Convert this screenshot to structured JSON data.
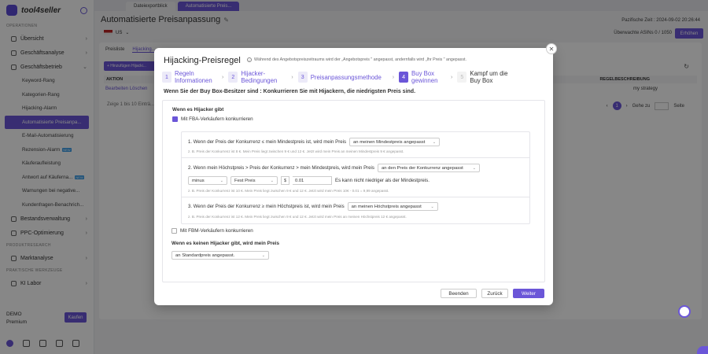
{
  "app": {
    "brand": "tool4seller",
    "sections": {
      "operations": "OPERATIONEN",
      "product_research": "PRODUKTRESEARCH",
      "tools": "PRAKTISCHE WERKZEUGE"
    },
    "nav_top": [
      {
        "label": "Übersicht"
      },
      {
        "label": "Geschäftsanalyse"
      },
      {
        "label": "Geschäftsbetrieb"
      }
    ],
    "nav_sub": [
      {
        "label": "Keyword-Rang"
      },
      {
        "label": "Kategorien-Rang"
      },
      {
        "label": "Hijacking-Alarm"
      },
      {
        "label": "Automatisierte Preisanpa..."
      },
      {
        "label": "E-Mail-Automatisierung"
      },
      {
        "label": "Rezension-Alarm",
        "badge": "NEW"
      },
      {
        "label": "Käuferaufleistung"
      },
      {
        "label": "Antwort auf Käuferna...",
        "badge": "NEW"
      },
      {
        "label": "Warnungen bei negative..."
      },
      {
        "label": "Kundenfragen-Benachrich..."
      }
    ],
    "nav_more": [
      {
        "label": "Bestandsverwaltung"
      },
      {
        "label": "PPC-Optimierung"
      }
    ],
    "nav_research": {
      "label": "Marktanalyse"
    },
    "nav_tools": {
      "label": "KI Labor"
    },
    "plan": {
      "line1": "DEMO",
      "line2": "Premium",
      "buy": "Kaufen"
    }
  },
  "tabs": [
    {
      "label": "Dateiexportblick"
    },
    {
      "label": "Automatisierte Preis..."
    }
  ],
  "page": {
    "title": "Automatisierte Preisanpassung",
    "timezone": "Pazifische Zeit : 2024-09-02 20:26:44",
    "marketplace": "US",
    "monitored": "Überwachte ASINs 0 / 1050",
    "raise": "Erhöhen",
    "subtabs": [
      "Preisliste",
      "Hijacking..."
    ],
    "add": "+ Hinzufügen Hijacki...",
    "col_action": "AKTION",
    "col_desc": "REGELBESCHREIBUNG",
    "row_actions": "Bearbeiten   Löschen",
    "row_strategy": "my strategy",
    "pagination_text": "Zeige 1 bis 10 Einträ...",
    "page_num": "1",
    "goto": "Gehe zu",
    "page_word": "Seite"
  },
  "modal": {
    "title": "Hijacking-Preisregel",
    "hint": "Während des Angebotspreiszeitraums wird der „Angebotspreis \" angepasst, andernfalls wird „Ihr Preis \" angepasst.",
    "steps": [
      {
        "num": "1",
        "label": "Regeln Informationen"
      },
      {
        "num": "2",
        "label": "Hijacker-Bedingungen"
      },
      {
        "num": "3",
        "label": "Preisanpassungsmethode"
      },
      {
        "num": "4",
        "label": "Buy Box gewinnen"
      },
      {
        "num": "5",
        "label": "Kampf um die Buy Box"
      }
    ],
    "banner": "Wenn Sie der Buy Box-Besitzer sind : Konkurrieren Sie mit Hijackern, die niedrigsten Preis sind.",
    "hijacker_heading": "Wenn es Hijacker gibt",
    "fba_check": "Mit FBA-Verkäufern konkurrieren",
    "rule1": "1. Wenn der Preis der Konkurrenz ≤ mein Mindestpreis ist, wird mein Preis",
    "rule1_select": "an meinen Mindestpreis angepasst",
    "rule1_note": "z. B. Preis der Konkurrenz ist 8 €. Mein Preis liegt zwischen 9 € und 12 €. Jetzt wird mein Preis an meinen Mindestpreis 9 € angepasst.",
    "rule2": "2. Wenn mein Höchstpreis > Preis der Konkurrenz > mein Mindestpreis, wird mein Preis",
    "rule2_select": "an den Preis der Konkurrenz angepasst",
    "rule2_minus": "minus",
    "rule2_fixed": "Fest Preis",
    "rule2_currency": "$",
    "rule2_value": "0.01",
    "rule2_tail": "Es kann nicht niedriger als der Mindestpreis.",
    "rule2_note": "z. B. Preis der Konkurrenz ist 10 €. Mein Preis liegt zwischen 9 € und 12 €. Jetzt wird mein Preis 10€ - 0.01 = 9,99 angepasst.",
    "rule3": "3. Wenn der Preis der Konkurrenz ≥ mein Höchstpreis ist, wird mein Preis",
    "rule3_select": "an meinen Höchstpreis angepasst",
    "rule3_note": "z. B. Preis der Konkurrenz ist 12 €. Mein Preis liegt zwischen 9 € und 12 €. Jetzt wird mein Preis an meinen Höchstpreis 12 € angepasst.",
    "fbm_check": "Mit FBM-Verkäufern konkurrieren",
    "no_hijacker_heading": "Wenn es keinen Hijacker gibt, wird mein Preis",
    "no_hijacker_select": "an Standardpreis angepasst.",
    "btn_end": "Beenden",
    "btn_back": "Zurück",
    "btn_next": "Weiter"
  },
  "colors": {
    "accent": "#6b56d8"
  }
}
